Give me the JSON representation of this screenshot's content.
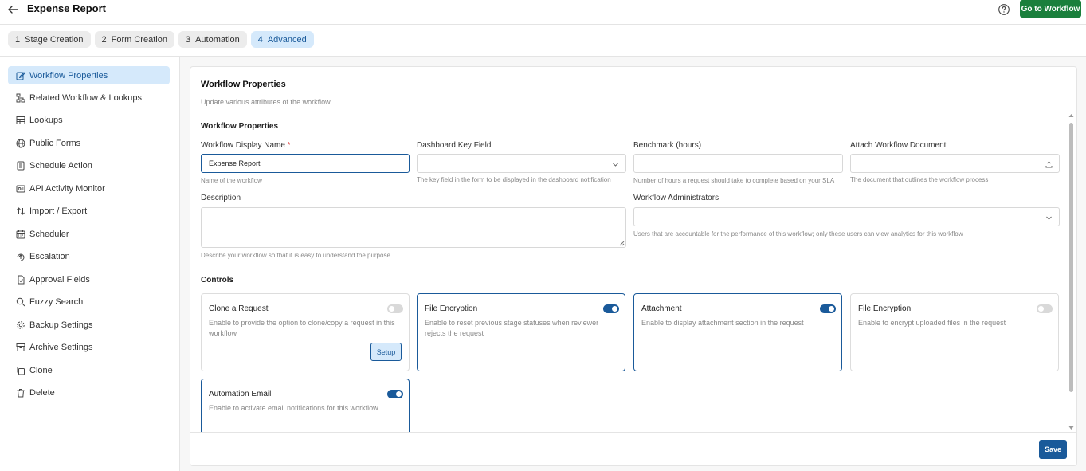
{
  "header": {
    "title": "Expense Report",
    "go_to_workflow_label": "Go to Workflow"
  },
  "tabs": [
    {
      "num": "1",
      "label": "Stage Creation"
    },
    {
      "num": "2",
      "label": "Form Creation"
    },
    {
      "num": "3",
      "label": "Automation"
    },
    {
      "num": "4",
      "label": "Advanced"
    }
  ],
  "sidebar": {
    "items": [
      {
        "label": "Workflow Properties",
        "icon": "edit-icon"
      },
      {
        "label": "Related Workflow & Lookups",
        "icon": "hierarchy-icon"
      },
      {
        "label": "Lookups",
        "icon": "table-icon"
      },
      {
        "label": "Public Forms",
        "icon": "globe-icon"
      },
      {
        "label": "Schedule Action",
        "icon": "document-icon"
      },
      {
        "label": "API Activity Monitor",
        "icon": "api-icon"
      },
      {
        "label": "Import / Export",
        "icon": "arrows-icon"
      },
      {
        "label": "Scheduler",
        "icon": "calendar-icon"
      },
      {
        "label": "Escalation",
        "icon": "escalation-icon"
      },
      {
        "label": "Approval Fields",
        "icon": "approval-icon"
      },
      {
        "label": "Fuzzy Search",
        "icon": "search-icon"
      },
      {
        "label": "Backup Settings",
        "icon": "gear-icon"
      },
      {
        "label": "Archive Settings",
        "icon": "archive-icon"
      },
      {
        "label": "Clone",
        "icon": "copy-icon"
      },
      {
        "label": "Delete",
        "icon": "trash-icon"
      }
    ]
  },
  "main": {
    "title": "Workflow Properties",
    "subtitle": "Update various attributes of the workflow",
    "section_title": "Workflow Properties",
    "fields": {
      "display_name": {
        "label": "Workflow Display Name",
        "required_mark": "*",
        "value": "Expense Report",
        "help": "Name of the workflow"
      },
      "dashboard_key": {
        "label": "Dashboard Key Field",
        "value": "",
        "help": "The key field in the form to be displayed in the dashboard notification"
      },
      "benchmark": {
        "label": "Benchmark (hours)",
        "value": "",
        "help": "Number of hours a request should take to complete based on your SLA"
      },
      "attach_doc": {
        "label": "Attach Workflow Document",
        "value": "",
        "help": "The document that outlines the workflow process"
      },
      "description": {
        "label": "Description",
        "value": "",
        "help": "Describe your workflow so that it is easy to understand the purpose"
      },
      "administrators": {
        "label": "Workflow Administrators",
        "value": "",
        "help": "Users that are accountable for the performance of this workflow; only these users can view analytics for this workflow"
      }
    },
    "controls_title": "Controls",
    "controls": [
      {
        "title": "Clone a Request",
        "desc": "Enable to provide the option to clone/copy a request in this workflow",
        "enabled": false,
        "button": "Setup"
      },
      {
        "title": "File Encryption",
        "desc": "Enable to reset previous stage statuses when reviewer rejects the request",
        "enabled": true
      },
      {
        "title": "Attachment",
        "desc": "Enable to display attachment section in the request",
        "enabled": true
      },
      {
        "title": "File Encryption",
        "desc": "Enable to encrypt uploaded files in the request",
        "enabled": false
      },
      {
        "title": "Automation Email",
        "desc": "Enable to activate email notifications for this workflow",
        "enabled": true
      }
    ],
    "save_label": "Save"
  },
  "colors": {
    "accent": "#1a5a9a",
    "accent_light": "#d5e9fb",
    "go_button": "#1a7f3c",
    "required": "#dd3333"
  }
}
